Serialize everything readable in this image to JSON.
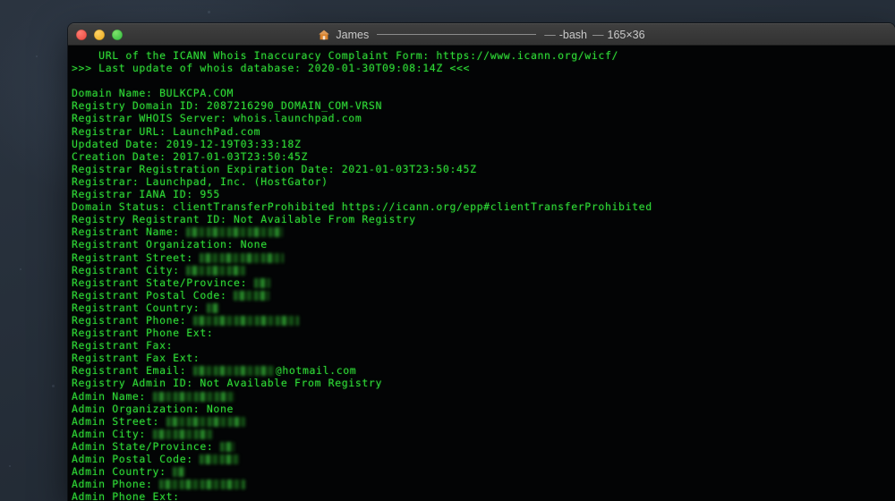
{
  "window": {
    "title_user": "James",
    "title_separator": "—",
    "title_shell": "-bash",
    "title_size": "165×36",
    "home_icon": "home-icon",
    "traffic_lights": [
      {
        "name": "close-button",
        "color": "#e8453c"
      },
      {
        "name": "minimize-button",
        "color": "#eaa81a"
      },
      {
        "name": "zoom-button",
        "color": "#2cb93b"
      }
    ]
  },
  "theme": {
    "terminal_background": "#030405",
    "terminal_foreground": "#2fdc36",
    "titlebar_background": "#3a3a3a",
    "desktop_background": "#262f3a"
  },
  "terminal": {
    "lines": [
      {
        "text": "    URL of the ICANN Whois Inaccuracy Complaint Form: https://www.icann.org/wicf/"
      },
      {
        "text": ">>> Last update of whois database: 2020-01-30T09:08:14Z <<<"
      },
      {
        "text": ""
      },
      {
        "text": "Domain Name: BULKCPA.COM"
      },
      {
        "text": "Registry Domain ID: 2087216290_DOMAIN_COM-VRSN"
      },
      {
        "text": "Registrar WHOIS Server: whois.launchpad.com"
      },
      {
        "text": "Registrar URL: LaunchPad.com"
      },
      {
        "text": "Updated Date: 2019-12-19T03:33:18Z"
      },
      {
        "text": "Creation Date: 2017-01-03T23:50:45Z"
      },
      {
        "text": "Registrar Registration Expiration Date: 2021-01-03T23:50:45Z"
      },
      {
        "text": "Registrar: Launchpad, Inc. (HostGator)"
      },
      {
        "text": "Registrar IANA ID: 955"
      },
      {
        "text": "Domain Status: clientTransferProhibited https://icann.org/epp#clientTransferProhibited"
      },
      {
        "text": "Registry Registrant ID: Not Available From Registry"
      },
      {
        "label": "Registrant Name: ",
        "redacted": 108
      },
      {
        "text": "Registrant Organization: None"
      },
      {
        "label": "Registrant Street: ",
        "redacted": 94
      },
      {
        "label": "Registrant City: ",
        "redacted": 66
      },
      {
        "label": "Registrant State/Province: ",
        "redacted": 18
      },
      {
        "label": "Registrant Postal Code: ",
        "redacted": 40
      },
      {
        "label": "Registrant Country: ",
        "redacted": 14
      },
      {
        "label": "Registrant Phone: ",
        "redacted": 118
      },
      {
        "text": "Registrant Phone Ext:"
      },
      {
        "text": "Registrant Fax:"
      },
      {
        "text": "Registrant Fax Ext:"
      },
      {
        "label": "Registrant Email: ",
        "redacted": 92,
        "suffix": "@hotmail.com"
      },
      {
        "text": "Registry Admin ID: Not Available From Registry"
      },
      {
        "label": "Admin Name: ",
        "redacted": 92
      },
      {
        "text": "Admin Organization: None"
      },
      {
        "label": "Admin Street: ",
        "redacted": 88
      },
      {
        "label": "Admin City: ",
        "redacted": 66
      },
      {
        "label": "Admin State/Province: ",
        "redacted": 16
      },
      {
        "label": "Admin Postal Code: ",
        "redacted": 44
      },
      {
        "label": "Admin Country: ",
        "redacted": 14
      },
      {
        "label": "Admin Phone: ",
        "redacted": 96
      },
      {
        "text": "Admin Phone Ext:"
      }
    ]
  }
}
